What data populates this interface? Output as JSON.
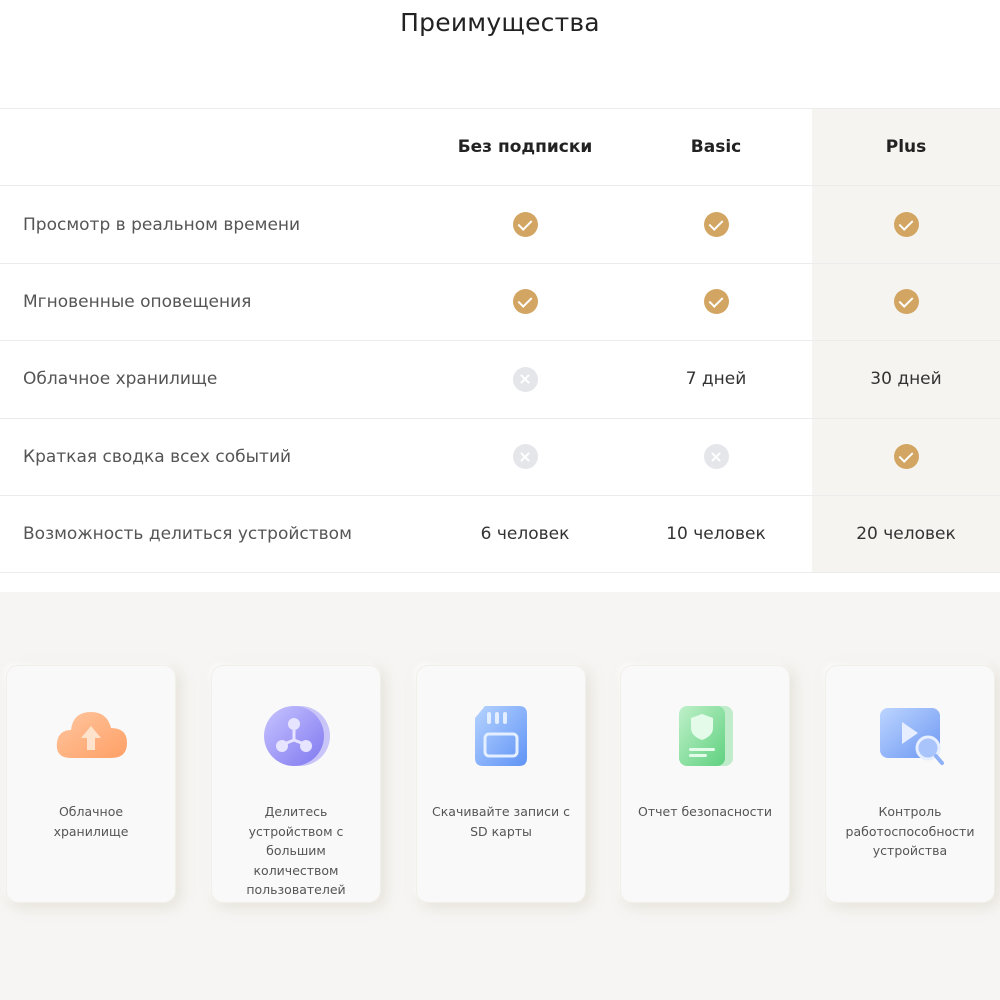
{
  "page_title": "Преимущества",
  "table": {
    "columns": [
      "Без подписки",
      "Basic",
      "Plus"
    ],
    "rows": [
      {
        "feature": "Просмотр в реальном времени",
        "cells": [
          {
            "type": "check"
          },
          {
            "type": "check"
          },
          {
            "type": "check"
          }
        ]
      },
      {
        "feature": "Мгновенные оповещения",
        "cells": [
          {
            "type": "check"
          },
          {
            "type": "check"
          },
          {
            "type": "check"
          }
        ]
      },
      {
        "feature": "Облачное хранилище",
        "cells": [
          {
            "type": "cross"
          },
          {
            "type": "text",
            "text": "7 дней"
          },
          {
            "type": "text",
            "text": "30 дней"
          }
        ]
      },
      {
        "feature": "Краткая сводка всех событий",
        "cells": [
          {
            "type": "cross"
          },
          {
            "type": "cross"
          },
          {
            "type": "check"
          }
        ]
      },
      {
        "feature": "Возможность делиться устройством",
        "cells": [
          {
            "type": "text",
            "text": "6 человек"
          },
          {
            "type": "text",
            "text": "10 человек"
          },
          {
            "type": "text",
            "text": "20 человек"
          }
        ]
      }
    ]
  },
  "icons": {
    "check": "check-circle-icon",
    "cross": "cross-circle-icon"
  },
  "colors": {
    "accent": "#d3a562",
    "cross": "#e5e6ea",
    "plus_column": "#f5f4f0"
  },
  "cards": [
    {
      "label": "Облачное хранилище",
      "icon": "cloud-upload-icon"
    },
    {
      "label": "Делитесь устройством с большим количеством пользователей",
      "icon": "share-nodes-icon"
    },
    {
      "label": "Скачивайте записи с SD карты",
      "icon": "sd-card-icon"
    },
    {
      "label": "Отчет безопасности",
      "icon": "security-report-icon"
    },
    {
      "label": "Контроль работоспособности устройства",
      "icon": "device-monitor-icon"
    }
  ]
}
